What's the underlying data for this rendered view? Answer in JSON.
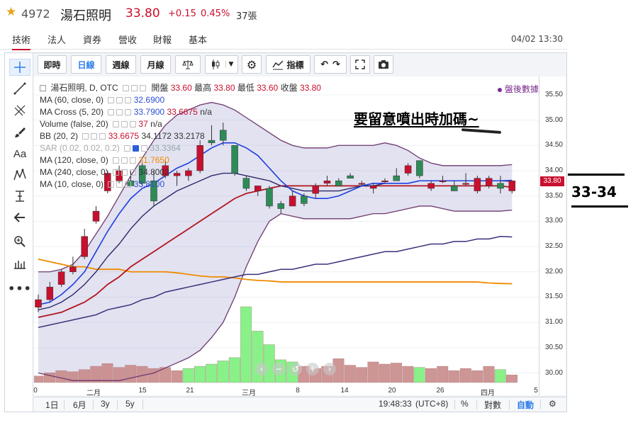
{
  "header": {
    "star_icon": "star-icon",
    "code": "4972",
    "name": "湯石照明",
    "price": "33.80",
    "change": "+0.15",
    "change_pct": "0.45%",
    "volume": "37張",
    "up_color": "#c8102e"
  },
  "tabs": [
    {
      "label": "技術",
      "active": true
    },
    {
      "label": "法人"
    },
    {
      "label": "資券"
    },
    {
      "label": "營收"
    },
    {
      "label": "財報"
    },
    {
      "label": "基本"
    }
  ],
  "datetime": "04/02 13:30",
  "toolbar": {
    "intraday": "即時",
    "daily": "日線",
    "weekly": "週線",
    "monthly": "月線",
    "indicators": "指標"
  },
  "legend": {
    "symbol": "湯石照明, D, OTC",
    "open_label": "開盤",
    "open": "33.60",
    "high_label": "最高",
    "high": "33.80",
    "low_label": "最低",
    "low": "33.60",
    "close_label": "收盤",
    "close": "33.80",
    "after_hours": "盤後數據",
    "rows": [
      {
        "label": "MA (60, close, 0)",
        "v1": "32.6900"
      },
      {
        "label": "MA Cross (5, 20)",
        "v1": "33.7900",
        "v2": "33.6675",
        "v3": "n/a"
      },
      {
        "label": "Volume (false, 20)",
        "v1": "37",
        "v2": "n/a"
      },
      {
        "label": "BB (20, 2)",
        "v1": "33.6675",
        "v2": "34.1172",
        "v3": "33.2178"
      },
      {
        "label": "SAR (0.02, 0.02, 0.2)",
        "v1": "33.3364"
      },
      {
        "label": "MA (120, close, 0)",
        "v1": "31.7650"
      },
      {
        "label": "MA (240, close, 0)",
        "v1": "34.8002"
      },
      {
        "label": "MA (10, close, 0)",
        "v1": "33.8100"
      }
    ]
  },
  "y_ticks": [
    "35.50",
    "35.00",
    "34.50",
    "34.00",
    "33.50",
    "33.00",
    "32.50",
    "32.00",
    "31.50",
    "31.00",
    "30.50",
    "30.00"
  ],
  "current_price_tag": "33.80",
  "x_ticks": [
    "0",
    "二月",
    "15",
    "21",
    "三月",
    "8",
    "14",
    "20",
    "26",
    "四月",
    "5"
  ],
  "bottom": {
    "r1": "1日",
    "r2": "6月",
    "r3": "3y",
    "r4": "5y",
    "time": "19:48:33",
    "tz": "(UTC+8)",
    "pct": "%",
    "log": "對數",
    "auto": "自動"
  },
  "annotations": {
    "note": "要留意噴出時加碼~",
    "range": "33-34"
  },
  "chart_data": {
    "type": "candlestick",
    "ylim": [
      29.7,
      35.75
    ],
    "up_color": "#c8102e",
    "down_color": "#2e8b57",
    "candles": [
      {
        "o": 31.3,
        "h": 31.55,
        "l": 31.2,
        "c": 31.45
      },
      {
        "o": 31.45,
        "h": 31.8,
        "l": 31.4,
        "c": 31.7
      },
      {
        "o": 31.75,
        "h": 32.05,
        "l": 31.7,
        "c": 32.0
      },
      {
        "o": 32.0,
        "h": 32.3,
        "l": 31.95,
        "c": 32.1
      },
      {
        "o": 32.3,
        "h": 32.85,
        "l": 32.25,
        "c": 32.7
      },
      {
        "o": 33.0,
        "h": 33.3,
        "l": 32.95,
        "c": 33.2
      },
      {
        "o": 33.6,
        "h": 34.0,
        "l": 33.55,
        "c": 33.95
      },
      {
        "o": 33.8,
        "h": 34.1,
        "l": 33.75,
        "c": 34.0
      },
      {
        "o": 33.8,
        "h": 34.0,
        "l": 33.7,
        "c": 33.7
      },
      {
        "o": 34.1,
        "h": 34.15,
        "l": 33.7,
        "c": 33.75
      },
      {
        "o": 33.8,
        "h": 34.0,
        "l": 33.3,
        "c": 33.4
      },
      {
        "o": 33.9,
        "h": 34.2,
        "l": 33.85,
        "c": 34.1
      },
      {
        "o": 33.9,
        "h": 34.0,
        "l": 33.7,
        "c": 33.95
      },
      {
        "o": 33.9,
        "h": 34.05,
        "l": 33.8,
        "c": 34.0
      },
      {
        "o": 34.0,
        "h": 34.6,
        "l": 33.95,
        "c": 34.5
      },
      {
        "o": 34.6,
        "h": 34.9,
        "l": 34.5,
        "c": 34.55
      },
      {
        "o": 34.8,
        "h": 34.95,
        "l": 34.5,
        "c": 34.6
      },
      {
        "o": 34.5,
        "h": 34.5,
        "l": 33.9,
        "c": 33.95
      },
      {
        "o": 33.85,
        "h": 33.9,
        "l": 33.6,
        "c": 33.65
      },
      {
        "o": 33.6,
        "h": 33.7,
        "l": 33.5,
        "c": 33.7
      },
      {
        "o": 33.65,
        "h": 33.7,
        "l": 33.25,
        "c": 33.3
      },
      {
        "o": 33.35,
        "h": 33.4,
        "l": 33.15,
        "c": 33.25
      },
      {
        "o": 33.3,
        "h": 33.6,
        "l": 33.3,
        "c": 33.5
      },
      {
        "o": 33.5,
        "h": 33.55,
        "l": 33.3,
        "c": 33.35
      },
      {
        "o": 33.55,
        "h": 33.75,
        "l": 33.45,
        "c": 33.7
      },
      {
        "o": 33.75,
        "h": 33.9,
        "l": 33.7,
        "c": 33.8
      },
      {
        "o": 33.8,
        "h": 33.85,
        "l": 33.7,
        "c": 33.7
      },
      {
        "o": 33.9,
        "h": 33.95,
        "l": 33.85,
        "c": 33.85
      },
      {
        "o": 33.75,
        "h": 33.8,
        "l": 33.7,
        "c": 33.75
      },
      {
        "o": 33.65,
        "h": 33.75,
        "l": 33.55,
        "c": 33.7
      },
      {
        "o": 33.8,
        "h": 33.85,
        "l": 33.75,
        "c": 33.8
      },
      {
        "o": 33.9,
        "h": 34.05,
        "l": 33.85,
        "c": 33.8
      },
      {
        "o": 33.95,
        "h": 34.15,
        "l": 33.9,
        "c": 34.1
      },
      {
        "o": 34.2,
        "h": 34.2,
        "l": 33.85,
        "c": 33.9
      },
      {
        "o": 33.65,
        "h": 33.8,
        "l": 33.6,
        "c": 33.75
      },
      {
        "o": 33.8,
        "h": 33.9,
        "l": 33.75,
        "c": 33.8
      },
      {
        "o": 33.7,
        "h": 33.8,
        "l": 33.6,
        "c": 33.6
      },
      {
        "o": 33.75,
        "h": 33.95,
        "l": 33.7,
        "c": 33.75
      },
      {
        "o": 33.6,
        "h": 33.9,
        "l": 33.55,
        "c": 33.85
      },
      {
        "o": 33.7,
        "h": 33.9,
        "l": 33.65,
        "c": 33.85
      },
      {
        "o": 33.75,
        "h": 33.9,
        "l": 33.55,
        "c": 33.65
      },
      {
        "o": 33.6,
        "h": 33.8,
        "l": 33.55,
        "c": 33.8
      }
    ],
    "volumes": [
      12,
      18,
      22,
      20,
      24,
      30,
      35,
      28,
      32,
      30,
      26,
      28,
      22,
      26,
      30,
      34,
      40,
      46,
      140,
      95,
      70,
      42,
      38,
      30,
      26,
      30,
      44,
      32,
      28,
      38,
      34,
      36,
      30,
      28,
      26,
      30,
      22,
      26,
      22,
      30,
      24,
      14
    ],
    "vol_colors": [
      "#c98a8a",
      "#c98a8a",
      "#c98a8a",
      "#c98a8a",
      "#c98a8a",
      "#c98a8a",
      "#c98a8a",
      "#c98a8a",
      "#c98a8a",
      "#c98a8a",
      "#c98a8a",
      "#c98a8a",
      "#c98a8a",
      "#7cf07c",
      "#7cf07c",
      "#7cf07c",
      "#7cf07c",
      "#7cf07c",
      "#7cf07c",
      "#7cf07c",
      "#7cf07c",
      "#7cf07c",
      "#7cf07c",
      "#c98a8a",
      "#c98a8a",
      "#c98a8a",
      "#c98a8a",
      "#c98a8a",
      "#c98a8a",
      "#c98a8a",
      "#c98a8a",
      "#c98a8a",
      "#c98a8a",
      "#7cf07c",
      "#c98a8a",
      "#c98a8a",
      "#c98a8a",
      "#c98a8a",
      "#c98a8a",
      "#c98a8a",
      "#7cf07c",
      "#c98a8a"
    ],
    "bb_upper": [
      32.0,
      32.0,
      32.05,
      32.15,
      32.4,
      32.75,
      33.1,
      33.5,
      33.9,
      34.25,
      34.6,
      34.9,
      35.1,
      35.2,
      35.3,
      35.35,
      35.3,
      35.2,
      35.05,
      34.9,
      34.75,
      34.6,
      34.5,
      34.45,
      34.45,
      34.45,
      34.5,
      34.5,
      34.5,
      34.5,
      34.55,
      34.5,
      34.4,
      34.25,
      34.15,
      34.1,
      34.1,
      34.1,
      34.1,
      34.1,
      34.1,
      34.12
    ],
    "bb_lower": [
      30.0,
      29.95,
      29.9,
      29.85,
      29.85,
      29.85,
      29.85,
      29.85,
      29.9,
      29.95,
      30.0,
      30.1,
      30.2,
      30.3,
      30.45,
      30.7,
      31.0,
      31.5,
      32.1,
      32.6,
      33.0,
      33.15,
      33.1,
      33.05,
      33.05,
      33.05,
      33.05,
      33.05,
      33.1,
      33.15,
      33.15,
      33.2,
      33.25,
      33.3,
      33.3,
      33.25,
      33.2,
      33.2,
      33.2,
      33.2,
      33.2,
      33.22
    ],
    "ma_blue": [
      31.35,
      31.4,
      31.55,
      31.75,
      32.0,
      32.4,
      32.8,
      33.15,
      33.45,
      33.65,
      33.75,
      33.9,
      34.05,
      34.15,
      34.3,
      34.45,
      34.55,
      34.55,
      34.45,
      34.3,
      34.05,
      33.8,
      33.6,
      33.5,
      33.45,
      33.45,
      33.5,
      33.6,
      33.7,
      33.75,
      33.75,
      33.75,
      33.75,
      33.8,
      33.8,
      33.8,
      33.8,
      33.8,
      33.8,
      33.8,
      33.8,
      33.81
    ],
    "ma_dark": [
      31.25,
      31.3,
      31.4,
      31.55,
      31.75,
      32.0,
      32.3,
      32.55,
      32.85,
      33.1,
      33.3,
      33.45,
      33.6,
      33.7,
      33.8,
      33.9,
      33.95,
      33.95,
      33.9,
      33.85,
      33.8,
      33.7,
      33.65,
      33.6,
      33.6,
      33.6,
      33.6,
      33.65,
      33.7,
      33.7,
      33.75,
      33.75,
      33.75,
      33.8,
      33.8,
      33.8,
      33.8,
      33.8,
      33.8,
      33.8,
      33.8,
      33.79
    ],
    "ma_red": [
      31.1,
      31.15,
      31.2,
      31.3,
      31.4,
      31.55,
      31.75,
      31.9,
      32.1,
      32.25,
      32.4,
      32.55,
      32.7,
      32.85,
      33.0,
      33.15,
      33.3,
      33.45,
      33.55,
      33.6,
      33.65,
      33.7,
      33.7,
      33.7,
      33.7,
      33.7,
      33.7,
      33.7,
      33.7,
      33.7,
      33.7,
      33.7,
      33.7,
      33.7,
      33.7,
      33.7,
      33.7,
      33.7,
      33.7,
      33.7,
      33.7,
      33.67
    ],
    "ma60": [
      30.9,
      30.95,
      31.0,
      31.05,
      31.1,
      31.15,
      31.25,
      31.3,
      31.35,
      31.45,
      31.5,
      31.6,
      31.65,
      31.7,
      31.75,
      31.8,
      31.85,
      31.9,
      31.95,
      31.95,
      32.0,
      32.05,
      32.05,
      32.1,
      32.15,
      32.15,
      32.2,
      32.25,
      32.3,
      32.35,
      32.4,
      32.4,
      32.45,
      32.5,
      32.55,
      32.55,
      32.6,
      32.6,
      32.65,
      32.65,
      32.7,
      32.69
    ],
    "ma120": [
      32.25,
      32.2,
      32.15,
      32.1,
      32.1,
      32.05,
      32.05,
      32.05,
      32.0,
      32.0,
      32.0,
      32.0,
      31.98,
      31.95,
      31.92,
      31.9,
      31.9,
      31.88,
      31.85,
      31.83,
      31.82,
      31.8,
      31.8,
      31.8,
      31.8,
      31.8,
      31.8,
      31.8,
      31.8,
      31.8,
      31.8,
      31.8,
      31.8,
      31.8,
      31.8,
      31.8,
      31.8,
      31.8,
      31.8,
      31.78,
      31.77,
      31.765
    ]
  }
}
